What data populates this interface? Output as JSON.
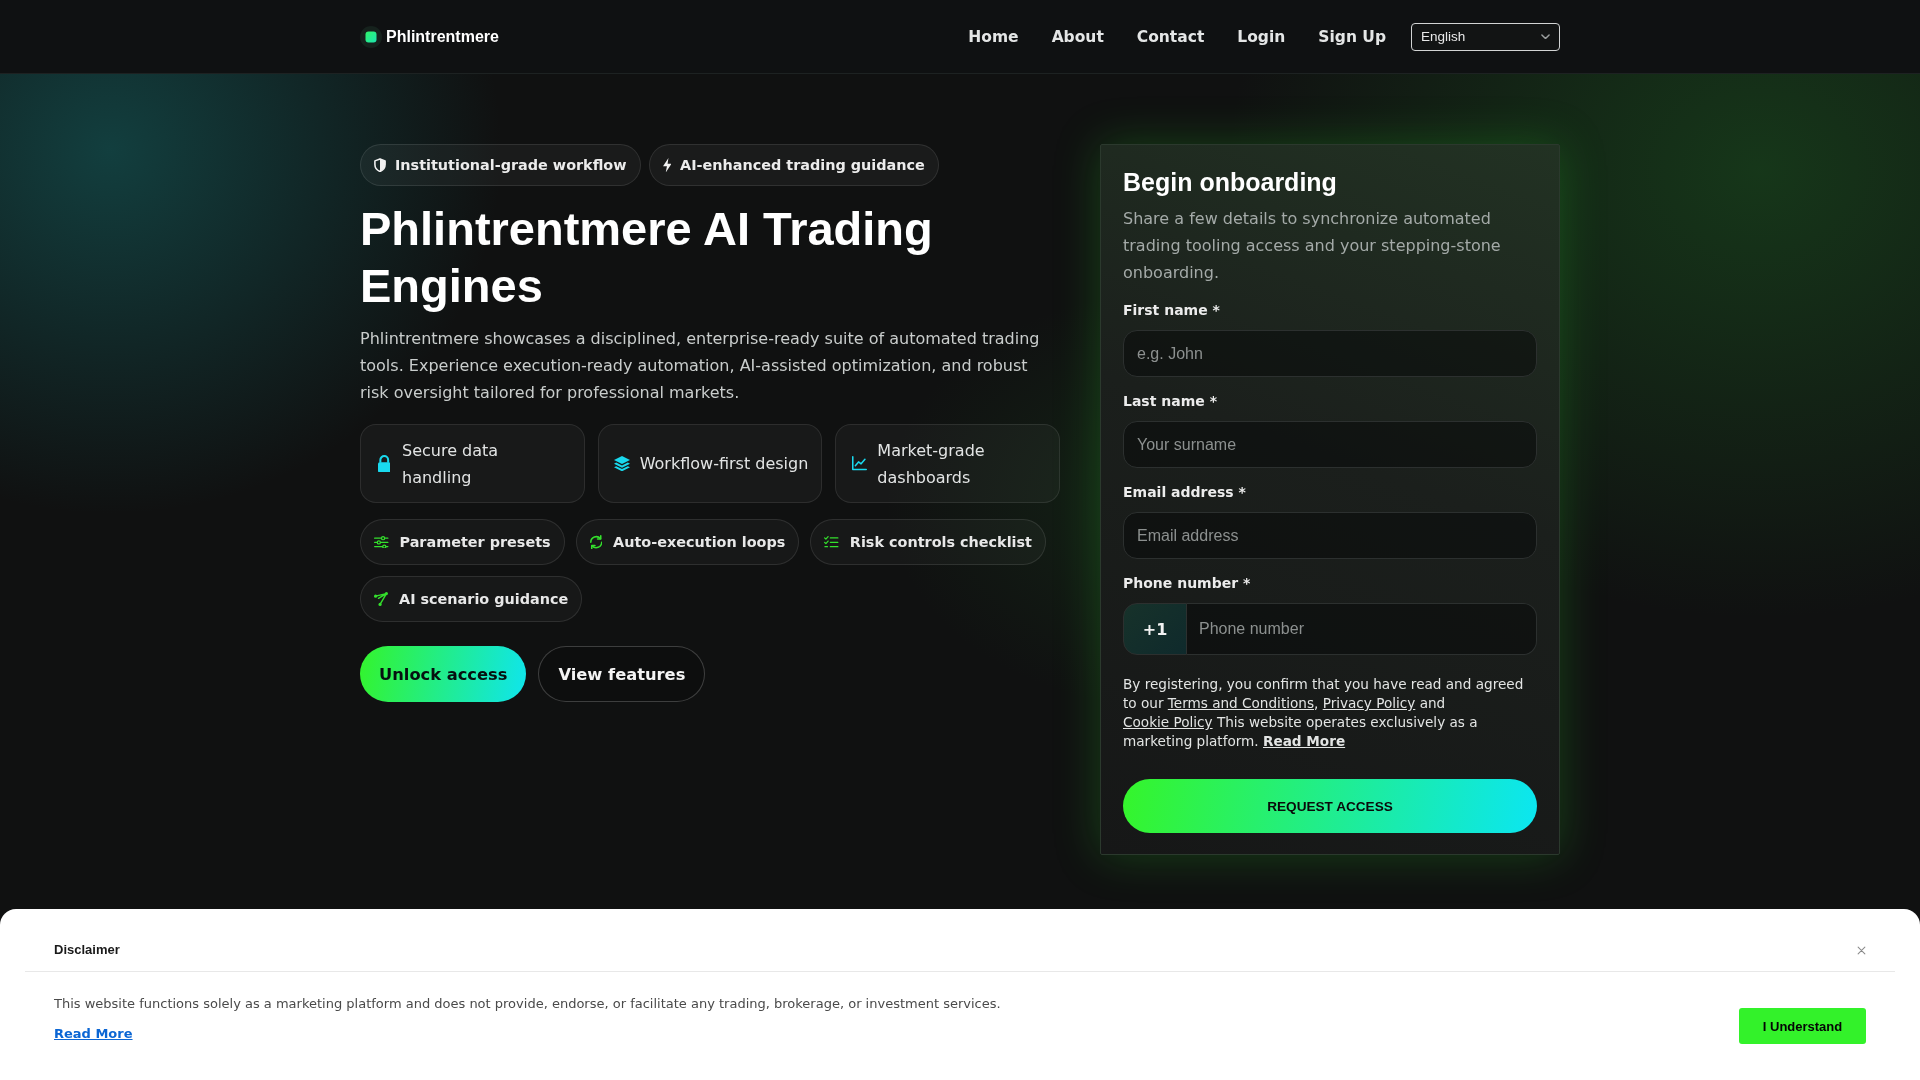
{
  "header": {
    "brand": "Phlintrentmere",
    "nav": [
      "Home",
      "About",
      "Contact",
      "Login",
      "Sign Up"
    ],
    "language_select": {
      "value": "English"
    }
  },
  "hero": {
    "badges": [
      "Institutional-grade workflow",
      "AI-enhanced trading guidance"
    ],
    "title": "Phlintrentmere AI Trading Engines",
    "description": "Phlintrentmere showcases a disciplined, enterprise-ready suite of automated trading tools. Experience execution-ready automation, AI-assisted optimization, and robust risk oversight tailored for professional markets.",
    "features": [
      "Secure data handling",
      "Workflow-first design",
      "Market-grade dashboards"
    ],
    "tags": [
      "Parameter presets",
      "Auto-execution loops",
      "Risk controls checklist",
      "AI scenario guidance"
    ],
    "buttons": [
      {
        "label": "Unlock access",
        "kind": "primary"
      },
      {
        "label": "View features",
        "kind": "outline"
      }
    ]
  },
  "signup_form": {
    "title": "Begin onboarding",
    "description": "Share a few details to synchronize automated trading tooling access and your stepping-stone onboarding.",
    "fields": [
      {
        "kind": "input",
        "label": "First name *",
        "placeholder": "e.g. John"
      },
      {
        "kind": "input",
        "label": "Last name *",
        "placeholder": "Your surname"
      },
      {
        "kind": "input",
        "label": "Email address *",
        "placeholder": "Email address"
      },
      {
        "kind": "phone",
        "label": "Phone number *",
        "prefix": "+1",
        "placeholder": "Phone number"
      }
    ],
    "consent": [
      {
        "kind": "text",
        "text": "By registering, you confirm that you have read and agreed to our "
      },
      {
        "kind": "link",
        "text": "Terms and Conditions"
      },
      {
        "kind": "text",
        "text": ", "
      },
      {
        "kind": "link",
        "text": "Privacy Policy"
      },
      {
        "kind": "text",
        "text": " and "
      },
      {
        "kind": "link",
        "text": "Cookie Policy"
      },
      {
        "kind": "text",
        "text": " This website operates exclusively as a marketing platform. "
      },
      {
        "kind": "strong_link",
        "text": "Read More"
      }
    ],
    "submit": "REQUEST ACCESS"
  },
  "disclaimer": {
    "title": "Disclaimer",
    "text": "This website functions solely as a marketing platform and does not provide, endorse, or facilitate any trading, brokerage, or investment services.",
    "link": "Read More",
    "button": "I Understand"
  }
}
